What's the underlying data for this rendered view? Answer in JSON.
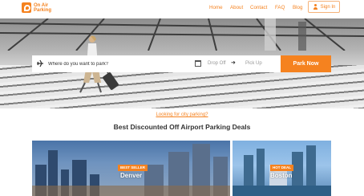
{
  "header": {
    "logo_line1": "On Air",
    "logo_line2": "Parking",
    "nav": [
      "Home",
      "About",
      "Contact",
      "FAQ",
      "Blog"
    ],
    "signin_label": "Sign In",
    "accent_color": "#f5821f"
  },
  "search": {
    "placeholder": "Where do you want to park?",
    "dropoff_label": "Drop Off",
    "pickup_label": "Pick Up",
    "submit_label": "Park Now",
    "icons": [
      "plane-icon",
      "calendar-icon",
      "arrow-right-icon"
    ]
  },
  "main": {
    "city_link": "Looking for city parking?",
    "deals_title": "Best Discounted Off Airport Parking Deals",
    "cards": [
      {
        "badge": "BEST SELLER",
        "city": "Denver"
      },
      {
        "badge": "HOT DEAL",
        "city": "Boston"
      }
    ]
  }
}
